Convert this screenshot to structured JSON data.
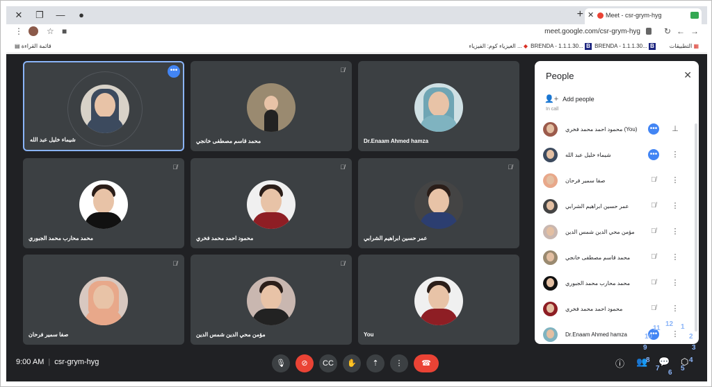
{
  "browser": {
    "tab_title": "Meet - csr-grym-hyg",
    "url": "meet.google.com/csr-grym-hyg",
    "bookmarks": [
      "التطبيقات",
      "BRENDA - 1.1.1.30...",
      "BRENDA - 1.1.1.30...",
      "الغيزياء كوم: الفيزياء ...",
      "قائمة القراءة"
    ]
  },
  "tiles": [
    {
      "name": "شيماء خليل عبد الله",
      "active": true,
      "muted": false
    },
    {
      "name": "محمد قاسم مصطفى خانجي",
      "muted": true
    },
    {
      "name": "Dr.Enaam Ahmed hamza",
      "muted": false
    },
    {
      "name": "محمد محارب محمد الجبوري",
      "muted": true
    },
    {
      "name": "محمود احمد محمد فخري",
      "muted": true
    },
    {
      "name": "عمر حسين ابراهيم الشرابي",
      "muted": true
    },
    {
      "name": "صفا سمير فرحان",
      "muted": true
    },
    {
      "name": "مؤمن محي الدين شمس الدين",
      "muted": true
    },
    {
      "name": "You",
      "muted": false
    }
  ],
  "panel": {
    "title": "People",
    "add_people": "Add people",
    "in_call": "In call",
    "people": [
      {
        "name": "محمود احمد محمد فخري (You)",
        "action": "more",
        "action2": "pin"
      },
      {
        "name": "شيماء خليل عبد الله",
        "action": "more",
        "action2": "menu"
      },
      {
        "name": "صفا سمير فرحان",
        "action": "mic-off",
        "action2": "menu"
      },
      {
        "name": "عمر حسين ابراهيم الشرابي",
        "action": "mic-off",
        "action2": "menu"
      },
      {
        "name": "مؤمن محي الدين شمس الدين",
        "action": "mic-off",
        "action2": "menu"
      },
      {
        "name": "محمد قاسم مصطفى خانجي",
        "action": "mic-off",
        "action2": "menu"
      },
      {
        "name": "محمد محارب محمد الجبوري",
        "action": "mic-off",
        "action2": "menu"
      },
      {
        "name": "محمود احمد محمد فخري",
        "action": "mic-off",
        "action2": "menu"
      },
      {
        "name": "Dr.Enaam Ahmed hamza",
        "action": "more",
        "action2": "menu"
      }
    ]
  },
  "bottom": {
    "time": "9:00 AM",
    "code": "csr-grym-hyg"
  },
  "annotations": [
    "1",
    "2",
    "3",
    "4",
    "5",
    "6",
    "7",
    "8",
    "9",
    "10",
    "11",
    "12"
  ]
}
